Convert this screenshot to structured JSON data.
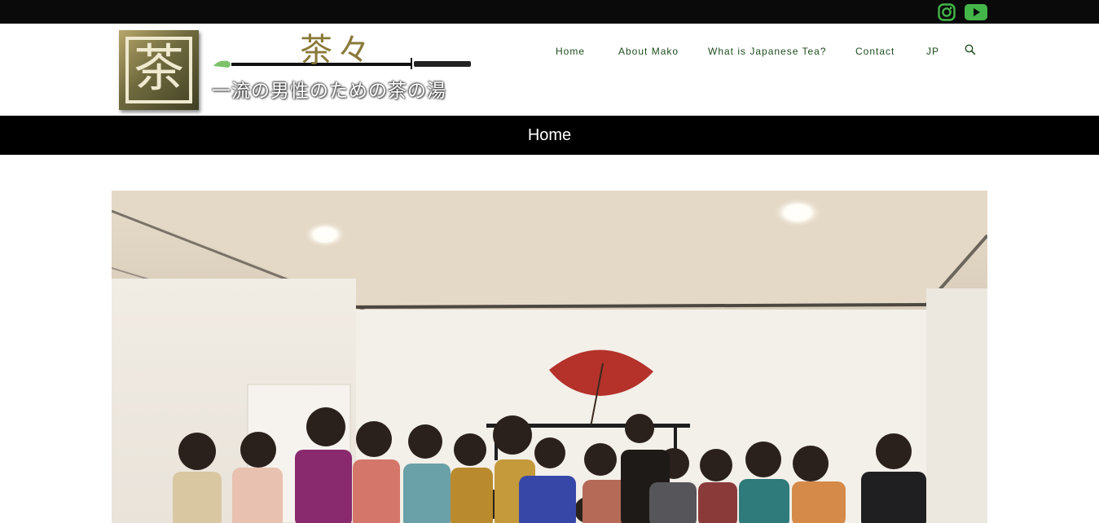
{
  "topbar": {
    "social": [
      {
        "icon": "instagram-icon",
        "color": "#43b549"
      },
      {
        "icon": "youtube-icon",
        "color": "#43b549"
      }
    ]
  },
  "logo": {
    "mark_text": "茶",
    "title": "茶々",
    "tagline": "一流の男性のための茶の湯"
  },
  "nav": {
    "items": [
      {
        "label": "Home"
      },
      {
        "label": "About Mako"
      },
      {
        "label": "What is Japanese Tea?"
      },
      {
        "label": "Contact"
      },
      {
        "label": "JP"
      }
    ],
    "search_icon": "search-icon"
  },
  "page": {
    "title": "Home"
  },
  "hero": {
    "image": "group-photo"
  },
  "colors": {
    "nav_text": "#1d4d1d",
    "topbar": "#0a0a0a",
    "titlebar": "#000000",
    "accent_green": "#43b549"
  }
}
